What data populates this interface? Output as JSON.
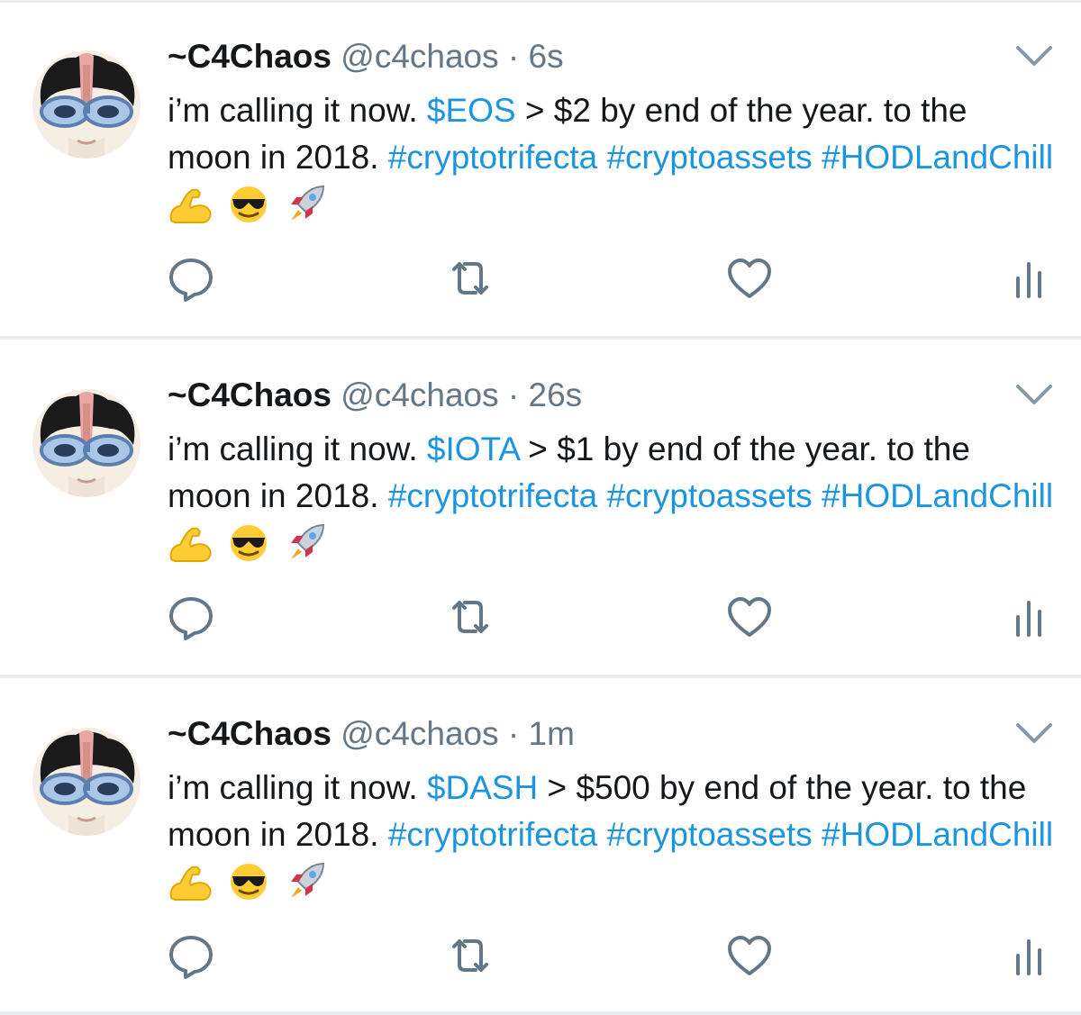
{
  "tweets": [
    {
      "name": "~C4Chaos",
      "handle": "@c4chaos",
      "separator": "·",
      "time": "6s",
      "text_pre": "i’m calling it now. ",
      "cashtag": "$EOS",
      "text_mid": " > $2 by end of the year. to the moon in 2018. ",
      "hashtag1": "#cryptotrifecta",
      "hashtag2": "#cryptoassets",
      "hashtag3": "#HODLandChill",
      "emojis": [
        "flexed-biceps-emoji",
        "sunglasses-face-emoji",
        "rocket-emoji"
      ]
    },
    {
      "name": "~C4Chaos",
      "handle": "@c4chaos",
      "separator": "·",
      "time": "26s",
      "text_pre": "i’m calling it now. ",
      "cashtag": "$IOTA",
      "text_mid": " > $1 by end of the year. to the moon in 2018. ",
      "hashtag1": "#cryptotrifecta",
      "hashtag2": "#cryptoassets",
      "hashtag3": "#HODLandChill",
      "emojis": [
        "flexed-biceps-emoji",
        "sunglasses-face-emoji",
        "rocket-emoji"
      ]
    },
    {
      "name": "~C4Chaos",
      "handle": "@c4chaos",
      "separator": "·",
      "time": "1m",
      "text_pre": "i’m calling it now. ",
      "cashtag": "$DASH",
      "text_mid": " > $500 by end of the year. to the moon in 2018. ",
      "hashtag1": "#cryptotrifecta",
      "hashtag2": "#cryptoassets",
      "hashtag3": "#HODLandChill",
      "emojis": [
        "flexed-biceps-emoji",
        "sunglasses-face-emoji",
        "rocket-emoji"
      ]
    }
  ],
  "actions": [
    "reply-icon",
    "retweet-icon",
    "like-icon",
    "analytics-icon"
  ],
  "colors": {
    "link": "#1b95e0",
    "text": "#14171a",
    "secondary": "#657786",
    "divider": "#e6ecf0"
  }
}
